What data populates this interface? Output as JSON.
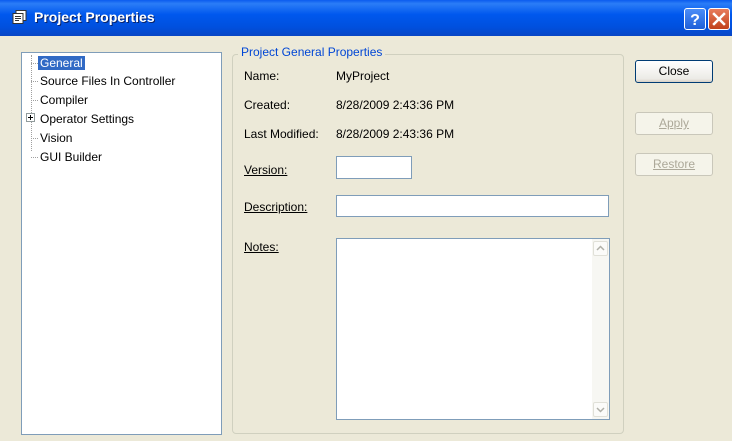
{
  "window": {
    "title": "Project Properties",
    "help_icon": "question-mark-icon",
    "close_icon": "close-x-icon"
  },
  "tree": {
    "items": [
      {
        "label": "General",
        "selected": true
      },
      {
        "label": "Source Files In Controller"
      },
      {
        "label": "Compiler"
      },
      {
        "label": "Operator Settings",
        "expandable": true
      },
      {
        "label": "Vision"
      },
      {
        "label": "GUI Builder"
      }
    ]
  },
  "group": {
    "title": "Project General Properties",
    "name_label": "Name:",
    "name_value": "MyProject",
    "created_label": "Created:",
    "created_value": "8/28/2009 2:43:36 PM",
    "modified_label": "Last Modified:",
    "modified_value": "8/28/2009 2:43:36 PM",
    "version_label": "Version:",
    "version_value": "",
    "description_label": "Description:",
    "description_value": "",
    "notes_label": "Notes:",
    "notes_value": ""
  },
  "buttons": {
    "close": "Close",
    "apply": "Apply",
    "restore": "Restore"
  },
  "colors": {
    "titlebar": "#0058EE",
    "selection": "#316AC5",
    "group_title": "#0046D5"
  }
}
